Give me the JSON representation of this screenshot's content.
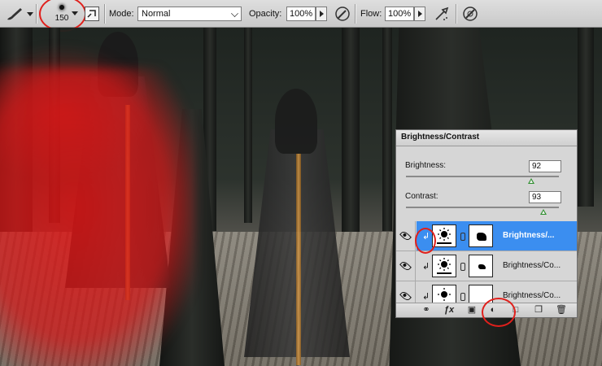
{
  "options_bar": {
    "brush_size": "150",
    "mode_label": "Mode:",
    "mode_value": "Normal",
    "opacity_label": "Opacity:",
    "opacity_value": "100%",
    "flow_label": "Flow:",
    "flow_value": "100%",
    "icons": [
      "brush-tool-icon",
      "brush-panel-toggle-icon",
      "tablet-pressure-opacity-icon",
      "airbrush-icon",
      "tablet-pressure-size-icon"
    ]
  },
  "adjustments_panel": {
    "title": "Brightness/Contrast",
    "brightness_label": "Brightness:",
    "brightness_value": "92",
    "brightness_level": 0.82,
    "contrast_label": "Contrast:",
    "contrast_value": "93",
    "contrast_level": 0.9
  },
  "layers": [
    {
      "name": "Brightness/...",
      "selected": true
    },
    {
      "name": "Brightness/Co...",
      "selected": false
    },
    {
      "name": "Brightness/Co...",
      "selected": false
    }
  ],
  "footer_icons": [
    "link-layers-icon",
    "fx-icon",
    "add-mask-icon",
    "new-adjustment-layer-icon",
    "new-group-icon",
    "new-layer-icon",
    "delete-icon"
  ],
  "colors": {
    "accent": "#3b8ef0",
    "annotation": "#e0201c",
    "paint": "#dc1414"
  }
}
